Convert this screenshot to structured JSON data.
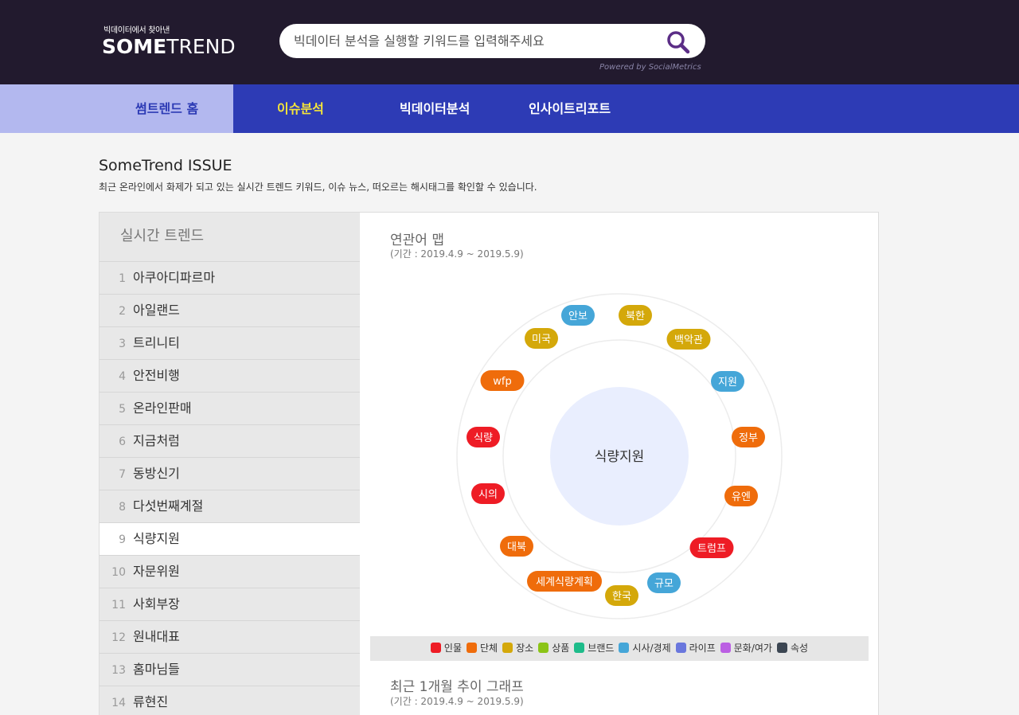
{
  "header": {
    "logo_sub": "빅데이터에서 찾아낸",
    "logo_some": "SOME",
    "logo_trend": "TREND",
    "search_placeholder": "빅데이터 분석을 실행할 키워드를 입력해주세요",
    "powered_by": "Powered by SocialMetrics"
  },
  "nav": {
    "home": "썸트렌드 홈",
    "items": [
      "이슈분석",
      "빅데이터분석",
      "인사이트리포트"
    ],
    "active_color": "#f4e43a"
  },
  "section": {
    "title": "SomeTrend ISSUE",
    "description": "최근 온라인에서 화제가 되고 있는 실시간 트렌드 키워드, 이슈 뉴스, 떠오르는 해시태그를 확인할 수 있습니다."
  },
  "trends": {
    "title": "실시간 트렌드",
    "items": [
      {
        "rank": "1",
        "keyword": "아쿠아디파르마"
      },
      {
        "rank": "2",
        "keyword": "아일랜드"
      },
      {
        "rank": "3",
        "keyword": "트리니티"
      },
      {
        "rank": "4",
        "keyword": "안전비행"
      },
      {
        "rank": "5",
        "keyword": "온라인판매"
      },
      {
        "rank": "6",
        "keyword": "지금처럼"
      },
      {
        "rank": "7",
        "keyword": "동방신기"
      },
      {
        "rank": "8",
        "keyword": "다섯번째계절"
      },
      {
        "rank": "9",
        "keyword": "식량지원"
      },
      {
        "rank": "10",
        "keyword": "자문위원"
      },
      {
        "rank": "11",
        "keyword": "사회부장"
      },
      {
        "rank": "12",
        "keyword": "원내대표"
      },
      {
        "rank": "13",
        "keyword": "홈마님들"
      },
      {
        "rank": "14",
        "keyword": "류현진"
      }
    ],
    "active_rank": "9"
  },
  "related_map": {
    "title": "연관어 맵",
    "period": "(기간 : 2019.4.9 ~ 2019.5.9)",
    "center": "식량지원",
    "words": [
      {
        "text": "안보",
        "cat": "시사/경제"
      },
      {
        "text": "북한",
        "cat": "장소"
      },
      {
        "text": "백악관",
        "cat": "장소"
      },
      {
        "text": "지원",
        "cat": "시사/경제"
      },
      {
        "text": "정부",
        "cat": "단체"
      },
      {
        "text": "유엔",
        "cat": "단체"
      },
      {
        "text": "트럼프",
        "cat": "인물"
      },
      {
        "text": "규모",
        "cat": "시사/경제"
      },
      {
        "text": "한국",
        "cat": "장소"
      },
      {
        "text": "세계식량계획",
        "cat": "단체"
      },
      {
        "text": "대북",
        "cat": "단체"
      },
      {
        "text": "시의",
        "cat": "인물"
      },
      {
        "text": "식량",
        "cat": "인물"
      },
      {
        "text": "wfp",
        "cat": "단체"
      },
      {
        "text": "미국",
        "cat": "장소"
      }
    ]
  },
  "legend": [
    {
      "label": "인물",
      "color": "#ee1c25"
    },
    {
      "label": "단체",
      "color": "#ef6c0b"
    },
    {
      "label": "장소",
      "color": "#d4a80a"
    },
    {
      "label": "상품",
      "color": "#8bc417"
    },
    {
      "label": "브랜드",
      "color": "#1ebc8a"
    },
    {
      "label": "시사/경제",
      "color": "#45a6d8"
    },
    {
      "label": "라이프",
      "color": "#6a77dd"
    },
    {
      "label": "문화/여가",
      "color": "#bb5fe3"
    },
    {
      "label": "속성",
      "color": "#3c4652"
    }
  ],
  "trend_graph": {
    "title": "최근 1개월 추이 그래프",
    "period": "(기간 : 2019.4.9 ~ 2019.5.9)"
  }
}
